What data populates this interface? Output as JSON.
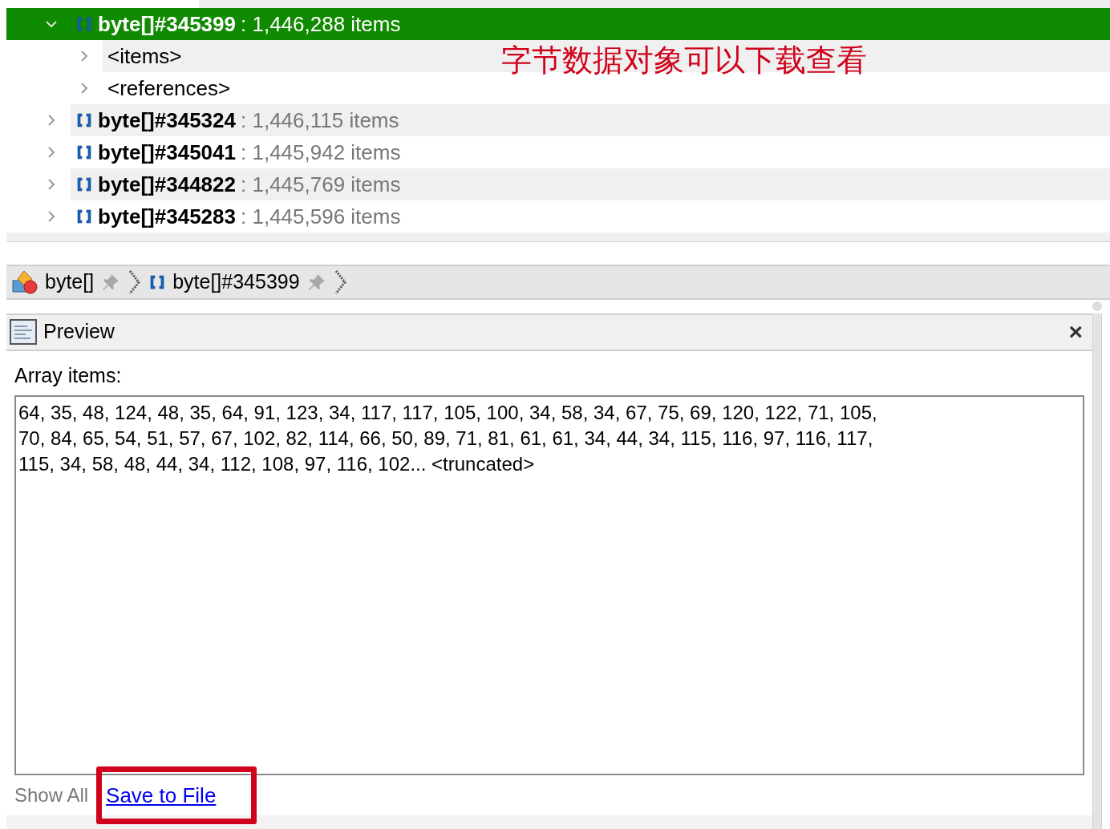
{
  "tree": [
    {
      "label": "byte[]#345399",
      "detail": ": 1,446,288 items",
      "selected": true,
      "expanded": true,
      "children": [
        {
          "label": "<items>",
          "selected": false
        },
        {
          "label": "<references>",
          "selected": false
        }
      ]
    },
    {
      "label": "byte[]#345324",
      "detail": ": 1,446,115 items",
      "selected": false,
      "expanded": false
    },
    {
      "label": "byte[]#345041",
      "detail": ": 1,445,942 items",
      "selected": false,
      "expanded": false
    },
    {
      "label": "byte[]#344822",
      "detail": ": 1,445,769 items",
      "selected": false,
      "expanded": false
    },
    {
      "label": "byte[]#345283",
      "detail": ": 1,445,596 items",
      "selected": false,
      "expanded": false
    }
  ],
  "annotation": {
    "text": "字节数据对象可以下载查看",
    "color": "#d0021b"
  },
  "breadcrumb": [
    {
      "kind": "class",
      "label": "byte[]"
    },
    {
      "kind": "array",
      "label": "byte[]#345399"
    }
  ],
  "preview": {
    "title": "Preview",
    "close": "×",
    "label": "Array items:",
    "lines": [
      "64, 35, 48, 124, 48, 35, 64, 91, 123, 34, 117, 117, 105, 100, 34, 58, 34, 67, 75, 69, 120, 122, 71, 105,",
      "70, 84, 65, 54, 51, 57, 67, 102, 82, 114, 66, 50, 89, 71, 81, 61, 61, 34, 44, 34, 115, 116, 97, 116, 117,",
      "115, 34, 58, 48, 44, 34, 112, 108, 97, 116, 102... <truncated>"
    ],
    "show_all": "Show All",
    "save": "Save to File"
  }
}
